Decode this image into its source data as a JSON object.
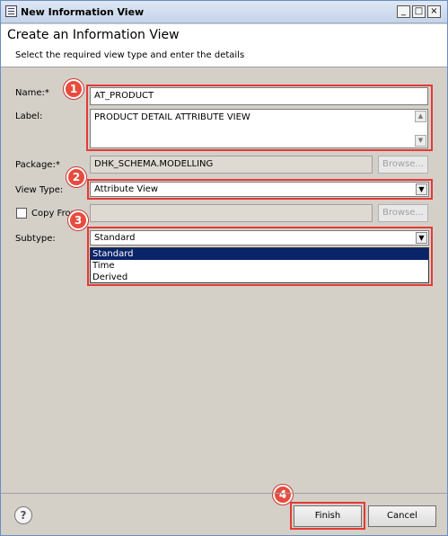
{
  "window": {
    "title": "New Information View",
    "buttons": {
      "minimize": "_",
      "maximize": "□",
      "close": "×"
    }
  },
  "header": {
    "title": "Create an Information View",
    "subtitle": "Select the required view type and enter the details"
  },
  "form": {
    "name_label": "Name:*",
    "name_value": "AT_PRODUCT",
    "label_label": "Label:",
    "label_value": "PRODUCT DETAIL ATTRIBUTE VIEW",
    "package_label": "Package:*",
    "package_value": "DHK_SCHEMA.MODELLING",
    "browse_label": "Browse...",
    "view_type_label": "View Type:",
    "view_type_value": "Attribute View",
    "copy_from_label": "Copy From",
    "copy_from_value": "",
    "browse2_label": "Browse...",
    "subtype_label": "Subtype:",
    "subtype_value": "Standard",
    "subtype_options": [
      "Standard",
      "Time",
      "Derived"
    ]
  },
  "callouts": [
    "1",
    "2",
    "3",
    "4"
  ],
  "footer": {
    "help_icon": "?",
    "finish_label": "Finish",
    "cancel_label": "Cancel"
  },
  "colors": {
    "highlight": "#e53935",
    "badge": "#e84c3d",
    "selection": "#0a246a"
  }
}
